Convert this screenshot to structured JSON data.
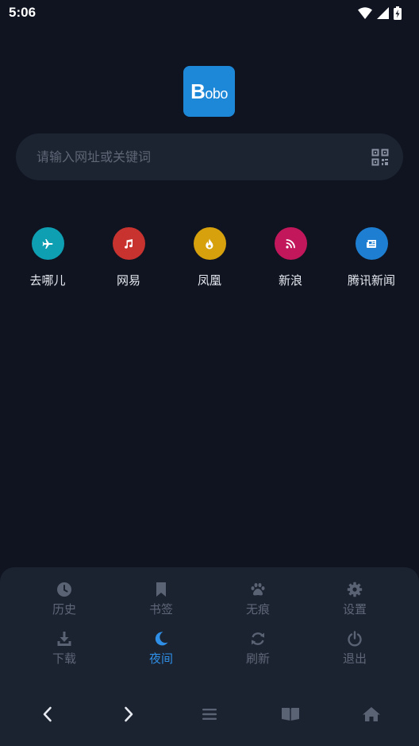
{
  "status": {
    "time": "5:06"
  },
  "logo": {
    "letter": "B",
    "rest": "obo"
  },
  "search": {
    "placeholder": "请输入网址或关键词"
  },
  "shortcuts": [
    {
      "label": "去哪儿",
      "color": "#0f9fb3",
      "icon": "plane-icon"
    },
    {
      "label": "网易",
      "color": "#c8332f",
      "icon": "music-note-icon"
    },
    {
      "label": "凤凰",
      "color": "#d6a10d",
      "icon": "fire-icon"
    },
    {
      "label": "新浪",
      "color": "#c2185b",
      "icon": "rss-icon"
    },
    {
      "label": "腾讯新闻",
      "color": "#1e7fd2",
      "icon": "newspaper-icon"
    }
  ],
  "menu": {
    "history": "历史",
    "bookmarks": "书签",
    "incognito": "无痕",
    "settings": "设置",
    "download": "下载",
    "night": "夜间",
    "refresh": "刷新",
    "exit": "退出"
  },
  "colors": {
    "background": "#0f1420",
    "panel": "#1b2230",
    "accent": "#2f8fe6",
    "muted_icon": "#5a6373"
  }
}
